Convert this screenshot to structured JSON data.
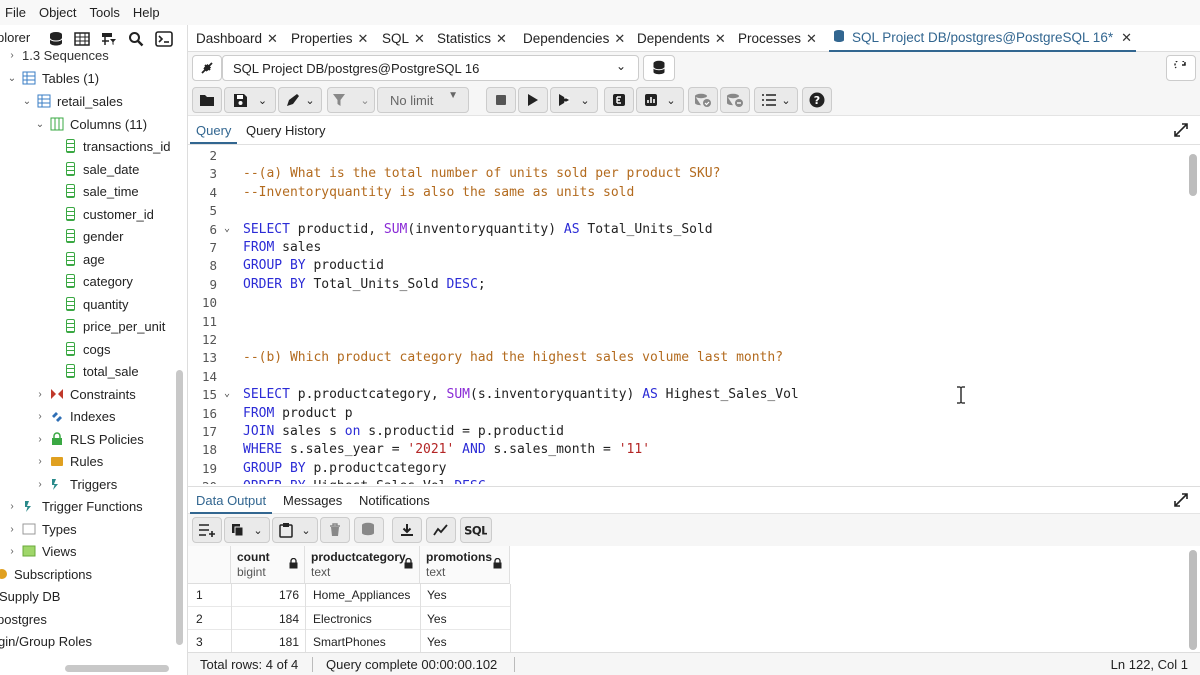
{
  "menu": [
    "File",
    "Object",
    "Tools",
    "Help"
  ],
  "tree": {
    "panel_title": "plorer",
    "rows": [
      {
        "label": "1.3 Sequences",
        "level": 1
      },
      {
        "label": "Tables (1)",
        "level": 1
      },
      {
        "label": "retail_sales",
        "level": 2
      },
      {
        "label": "Columns (11)",
        "level": 3
      },
      {
        "label": "transactions_id",
        "level": 4
      },
      {
        "label": "sale_date",
        "level": 4
      },
      {
        "label": "sale_time",
        "level": 4
      },
      {
        "label": "customer_id",
        "level": 4
      },
      {
        "label": "gender",
        "level": 4
      },
      {
        "label": "age",
        "level": 4
      },
      {
        "label": "category",
        "level": 4
      },
      {
        "label": "quantity",
        "level": 4
      },
      {
        "label": "price_per_unit",
        "level": 4
      },
      {
        "label": "cogs",
        "level": 4
      },
      {
        "label": "total_sale",
        "level": 4
      },
      {
        "label": "Constraints",
        "level": 3
      },
      {
        "label": "Indexes",
        "level": 3
      },
      {
        "label": "RLS Policies",
        "level": 3
      },
      {
        "label": "Rules",
        "level": 3
      },
      {
        "label": "Triggers",
        "level": 3
      },
      {
        "label": "Trigger Functions",
        "level": 1
      },
      {
        "label": "Types",
        "level": 1
      },
      {
        "label": "Views",
        "level": 1
      },
      {
        "label": "Subscriptions",
        "level": 0
      },
      {
        "label": "Supply DB",
        "level": -1
      },
      {
        "label": "postgres",
        "level": -1
      },
      {
        "label": "gin/Group Roles",
        "level": -1
      }
    ]
  },
  "tabs": [
    {
      "label": "Dashboard"
    },
    {
      "label": "Properties"
    },
    {
      "label": "SQL"
    },
    {
      "label": "Statistics"
    },
    {
      "label": "Dependencies"
    },
    {
      "label": "Dependents"
    },
    {
      "label": "Processes"
    },
    {
      "label": "SQL Project DB/postgres@PostgreSQL 16*"
    }
  ],
  "connection": {
    "selected": "SQL Project DB/postgres@PostgreSQL 16"
  },
  "toolbar": {
    "limit": "No limit"
  },
  "query_tabs": [
    "Query",
    "Query History"
  ],
  "editor_lines": [
    {
      "n": "2",
      "tokens": []
    },
    {
      "n": "3",
      "tokens": [
        {
          "t": "--(a) What is the total number of units sold per product SKU?",
          "c": "cm"
        }
      ]
    },
    {
      "n": "4",
      "tokens": [
        {
          "t": "--Inventoryquantity is also the same as units sold",
          "c": "cm"
        }
      ]
    },
    {
      "n": "5",
      "tokens": []
    },
    {
      "n": "6",
      "fold": true,
      "tokens": [
        {
          "t": "SELECT",
          "c": "kw"
        },
        {
          "t": " productid, ",
          "c": ""
        },
        {
          "t": "SUM",
          "c": "fn"
        },
        {
          "t": "(inventoryquantity) ",
          "c": ""
        },
        {
          "t": "AS",
          "c": "kw"
        },
        {
          "t": " Total_Units_Sold",
          "c": ""
        }
      ]
    },
    {
      "n": "7",
      "tokens": [
        {
          "t": "FROM",
          "c": "kw"
        },
        {
          "t": " sales",
          "c": ""
        }
      ]
    },
    {
      "n": "8",
      "tokens": [
        {
          "t": "GROUP BY",
          "c": "kw"
        },
        {
          "t": " productid",
          "c": ""
        }
      ]
    },
    {
      "n": "9",
      "tokens": [
        {
          "t": "ORDER BY",
          "c": "kw"
        },
        {
          "t": " Total_Units_Sold ",
          "c": ""
        },
        {
          "t": "DESC",
          "c": "kw"
        },
        {
          "t": ";",
          "c": ""
        }
      ]
    },
    {
      "n": "10",
      "tokens": []
    },
    {
      "n": "11",
      "tokens": []
    },
    {
      "n": "12",
      "tokens": []
    },
    {
      "n": "13",
      "tokens": [
        {
          "t": "--(b) Which product category had the highest sales volume last month?",
          "c": "cm"
        }
      ]
    },
    {
      "n": "14",
      "tokens": []
    },
    {
      "n": "15",
      "fold": true,
      "tokens": [
        {
          "t": "SELECT",
          "c": "kw"
        },
        {
          "t": " p.productcategory, ",
          "c": ""
        },
        {
          "t": "SUM",
          "c": "fn"
        },
        {
          "t": "(s.inventoryquantity) ",
          "c": ""
        },
        {
          "t": "AS",
          "c": "kw"
        },
        {
          "t": " Highest_Sales_Vol",
          "c": ""
        }
      ]
    },
    {
      "n": "16",
      "tokens": [
        {
          "t": "FROM",
          "c": "kw"
        },
        {
          "t": " product p",
          "c": ""
        }
      ]
    },
    {
      "n": "17",
      "tokens": [
        {
          "t": "JOIN",
          "c": "kw"
        },
        {
          "t": " sales s ",
          "c": ""
        },
        {
          "t": "on",
          "c": "kw"
        },
        {
          "t": " s.productid = p.productid",
          "c": ""
        }
      ]
    },
    {
      "n": "18",
      "tokens": [
        {
          "t": "WHERE",
          "c": "kw"
        },
        {
          "t": " s.sales_year = ",
          "c": ""
        },
        {
          "t": "'2021'",
          "c": "str"
        },
        {
          "t": " ",
          "c": ""
        },
        {
          "t": "AND",
          "c": "kw"
        },
        {
          "t": " s.sales_month = ",
          "c": ""
        },
        {
          "t": "'11'",
          "c": "str"
        }
      ]
    },
    {
      "n": "19",
      "tokens": [
        {
          "t": "GROUP BY",
          "c": "kw"
        },
        {
          "t": " p.productcategory",
          "c": ""
        }
      ]
    },
    {
      "n": "20",
      "tokens": [
        {
          "t": "ORDER BY",
          "c": "kw"
        },
        {
          "t": " Highest_Sales_Vol ",
          "c": ""
        },
        {
          "t": "DESC",
          "c": "kw"
        }
      ]
    }
  ],
  "output_tabs": [
    "Data Output",
    "Messages",
    "Notifications"
  ],
  "grid": {
    "columns": [
      {
        "name": "count",
        "type": "bigint"
      },
      {
        "name": "productcategory",
        "type": "text"
      },
      {
        "name": "promotions",
        "type": "text"
      }
    ],
    "rows": [
      {
        "n": "1",
        "cells": [
          "176",
          "Home_Appliances",
          "Yes"
        ]
      },
      {
        "n": "2",
        "cells": [
          "184",
          "Electronics",
          "Yes"
        ]
      },
      {
        "n": "3",
        "cells": [
          "181",
          "SmartPhones",
          "Yes"
        ]
      }
    ]
  },
  "status": {
    "total_rows": "Total rows: 4 of 4",
    "query_status": "Query complete 00:00:00.102",
    "position": "Ln 122, Col 1"
  },
  "colors": {
    "accent": "#326690",
    "keyword": "#2b2bd6",
    "function": "#8a2bd6",
    "comment": "#b36b1f",
    "string": "#b32424",
    "column_icon": "#3aa843"
  }
}
